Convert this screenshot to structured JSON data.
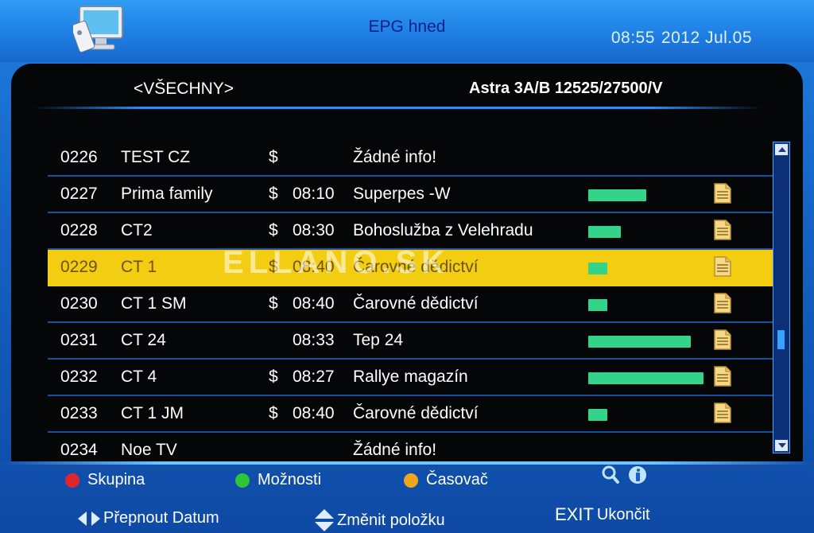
{
  "header": {
    "title": "EPG hned",
    "time": "08:55",
    "date": "2012 Jul.05"
  },
  "subheader": {
    "group": "<VŠECHNY>",
    "satellite": "Astra 3A/B 12525/27500/V"
  },
  "channels": [
    {
      "num": "0226",
      "name": "TEST CZ",
      "cas": "$",
      "time": "",
      "program": "Žádné info!",
      "progress": 0,
      "has_info": false
    },
    {
      "num": "0227",
      "name": "Prima family",
      "cas": "$",
      "time": "08:10",
      "program": "Superpes -W",
      "progress": 0.49,
      "has_info": true
    },
    {
      "num": "0228",
      "name": "CT2",
      "cas": "$",
      "time": "08:30",
      "program": "Bohoslužba z Velehradu",
      "progress": 0.28,
      "has_info": true
    },
    {
      "num": "0229",
      "name": "CT 1",
      "cas": "$",
      "time": "08:40",
      "program": "Čarovné dědictví",
      "progress": 0.16,
      "has_info": true
    },
    {
      "num": "0230",
      "name": "CT 1 SM",
      "cas": "$",
      "time": "08:40",
      "program": "Čarovné dědictví",
      "progress": 0.16,
      "has_info": true
    },
    {
      "num": "0231",
      "name": "CT 24",
      "cas": "",
      "time": "08:33",
      "program": "Tep 24",
      "progress": 0.87,
      "has_info": true
    },
    {
      "num": "0232",
      "name": "CT 4",
      "cas": "$",
      "time": "08:27",
      "program": "Rallye magazín",
      "progress": 0.98,
      "has_info": true
    },
    {
      "num": "0233",
      "name": "CT 1 JM",
      "cas": "$",
      "time": "08:40",
      "program": "Čarovné dědictví",
      "progress": 0.16,
      "has_info": true
    },
    {
      "num": "0234",
      "name": "Noe TV",
      "cas": "",
      "time": "",
      "program": "Žádné info!",
      "progress": 0,
      "has_info": false
    }
  ],
  "selected_index": 3,
  "watermark": "ELLANO.SK",
  "legend": {
    "red": "Skupina",
    "green": "Možnosti",
    "yellow": "Časovač"
  },
  "hints": {
    "left_right": "Přepnout Datum",
    "up_down": "Změnit položku",
    "exit_key": "EXIT",
    "exit": "Ukončit"
  },
  "colors": {
    "red": "#e0262a",
    "green": "#2fc43a",
    "yellow": "#f0a51c",
    "selected_row": "#f2cd12",
    "progress": "#33d389"
  }
}
